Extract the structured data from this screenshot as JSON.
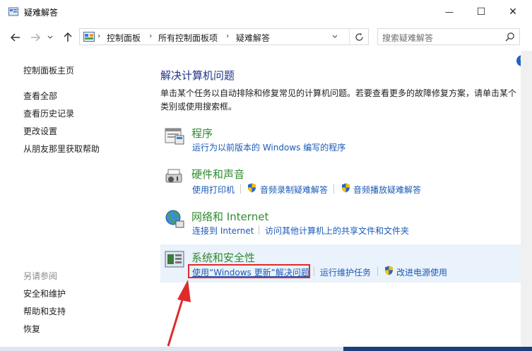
{
  "window": {
    "title": "疑难解答",
    "controls": {
      "minimize": "—",
      "maximize": "☐",
      "close": "✕"
    }
  },
  "address": {
    "crumbs": [
      "控制面板",
      "所有控制面板项",
      "疑难解答"
    ],
    "search_placeholder": "搜索疑难解答"
  },
  "left_nav": {
    "home": "控制面板主页",
    "links": [
      "查看全部",
      "查看历史记录",
      "更改设置",
      "从朋友那里获取帮助"
    ],
    "see_also_title": "另请参阅",
    "see_also": [
      "安全和维护",
      "帮助和支持",
      "恢复"
    ]
  },
  "main": {
    "heading": "解决计算机问题",
    "description": "单击某个任务以自动排除和修复常见的计算机问题。若要查看更多的故障修复方案，请单击某个类别或使用搜索框。",
    "categories": [
      {
        "title": "程序",
        "links": [
          "运行为以前版本的 Windows 编写的程序"
        ],
        "icon": "programs-icon"
      },
      {
        "title": "硬件和声音",
        "links": [
          "使用打印机",
          "音频录制疑难解答",
          "音频播放疑难解答"
        ],
        "icon": "hardware-sound-icon"
      },
      {
        "title": "网络和 Internet",
        "links": [
          "连接到 Internet",
          "访问其他计算机上的共享文件和文件夹"
        ],
        "icon": "network-icon"
      },
      {
        "title": "系统和安全性",
        "links": [
          "使用“Windows 更新”解决问题",
          "运行维护任务",
          "改进电源使用"
        ],
        "icon": "system-security-icon"
      }
    ]
  },
  "help": "?",
  "colors": {
    "heading": "#1e3287",
    "category": "#2e8b2e",
    "link": "#1a5ab8",
    "highlight": "#e02b2b"
  }
}
